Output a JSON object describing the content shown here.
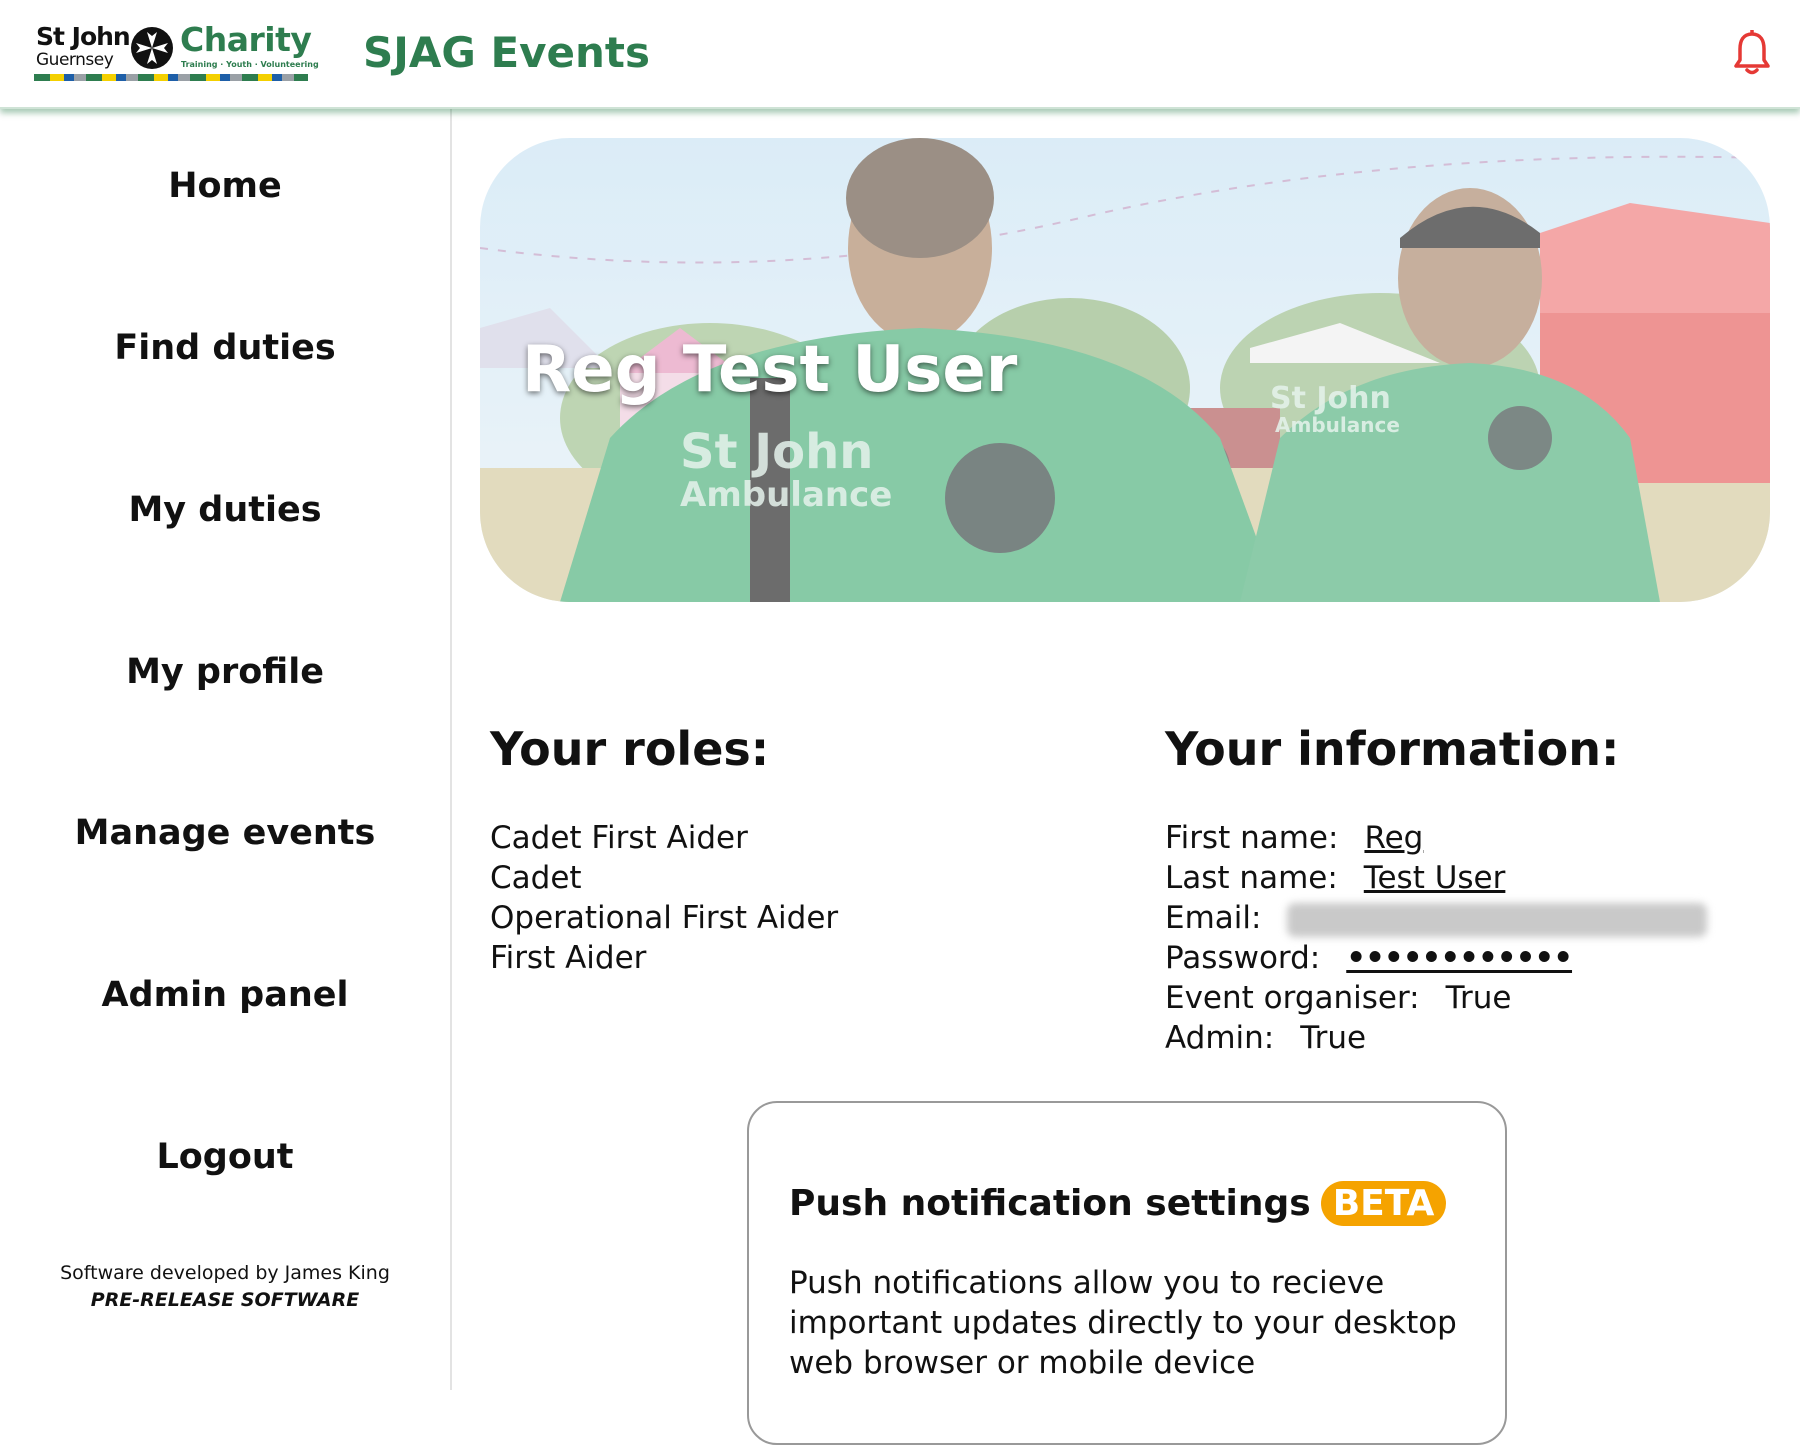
{
  "header": {
    "logo": {
      "line1": "St John",
      "line2": "Guernsey",
      "charity": "Charity",
      "tagline": "Training · Youth · Volunteering"
    },
    "title": "SJAG Events",
    "bell_icon": "bell-icon",
    "bell_color": "#e53935"
  },
  "sidebar": {
    "items": [
      {
        "label": "Home"
      },
      {
        "label": "Find duties"
      },
      {
        "label": "My duties"
      },
      {
        "label": "My profile"
      },
      {
        "label": "Manage events"
      },
      {
        "label": "Admin panel"
      },
      {
        "label": "Logout"
      }
    ],
    "credit": "Software developed by James King",
    "release_note": "PRE-RELEASE SOFTWARE"
  },
  "banner": {
    "title": "Reg Test User",
    "jacket_text_1": "St John",
    "jacket_text_2": "Ambulance"
  },
  "roles": {
    "heading": "Your roles:",
    "items": [
      "Cadet First Aider",
      "Cadet",
      "Operational First Aider",
      "First Aider"
    ]
  },
  "info": {
    "heading": "Your information:",
    "first_name_label": "First name:",
    "first_name": "Reg",
    "last_name_label": "Last name:",
    "last_name": "Test User",
    "email_label": "Email:",
    "password_label": "Password:",
    "password": "••••••••••••",
    "organiser_label": "Event organiser:",
    "organiser": "True",
    "admin_label": "Admin:",
    "admin": "True"
  },
  "push": {
    "title": "Push notification settings",
    "badge": "BETA",
    "body": "Push notifications allow you to recieve important updates directly to your desktop web browser or mobile device"
  },
  "colors": {
    "brand_green": "#2e7d4f",
    "beta_orange": "#f5a300"
  }
}
